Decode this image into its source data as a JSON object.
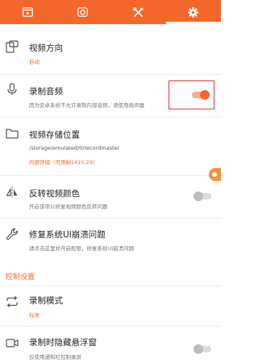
{
  "tabs": [
    {
      "icon": "video-icon",
      "active": false
    },
    {
      "icon": "camera-icon",
      "active": false
    },
    {
      "icon": "tools-icon",
      "active": false
    },
    {
      "icon": "gear-icon",
      "active": true
    }
  ],
  "settings": {
    "orientation": {
      "title": "视频方向",
      "value": "自动"
    },
    "audio": {
      "title": "录制音频",
      "desc": "因为安卓系统不允许录制内部音频，请使用扬声器",
      "enabled": true
    },
    "storage": {
      "title": "视频存储位置",
      "path": "/storage/emulated/0/recordmaster",
      "info": "内部存储（可用剩1415.29）"
    },
    "invert": {
      "title": "反转视频颜色",
      "desc": "开启该项以修复视频颜色反转问题",
      "enabled": false
    },
    "fix_ui": {
      "title": "修复系统UI崩溃问题",
      "desc": "请点击这里并开启权限，修复系统UI崩溃问题"
    }
  },
  "control_section": {
    "header": "控制设置",
    "mode": {
      "title": "录制模式",
      "value": "标准"
    },
    "hide_float": {
      "title": "录制时隐藏悬浮窗",
      "desc": "仅使用通知栏控制录屏",
      "enabled": false
    }
  },
  "colors": {
    "accent": "#f4672a",
    "highlight": "#e53935"
  }
}
